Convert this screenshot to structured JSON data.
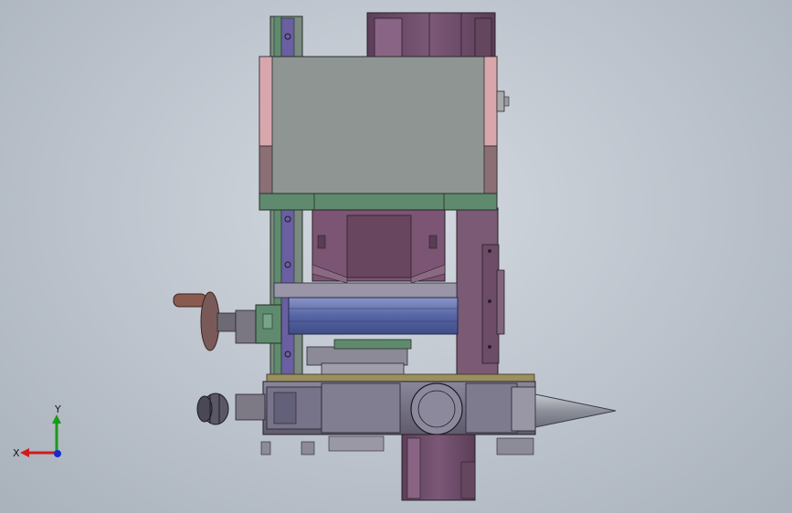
{
  "colors": {
    "background": "#c4cad2",
    "housing_gray": "#8e9592",
    "housing_pink": "#d8a7ae",
    "rail_green": "#5f8a6e",
    "carriage_purple": "#7b5573",
    "motor_purple": "#6f4d6a",
    "slide_blue": "#5a6aa8",
    "body_gray": "#7d7a8a",
    "hand_wheel": "#8a5a50",
    "tip_gray": "#a6a9b2",
    "axis_x": "#d11a1a",
    "axis_y": "#1a9a1a",
    "axis_z": "#1a2ad1"
  },
  "triad": {
    "x_label": "X",
    "y_label": "Y"
  }
}
